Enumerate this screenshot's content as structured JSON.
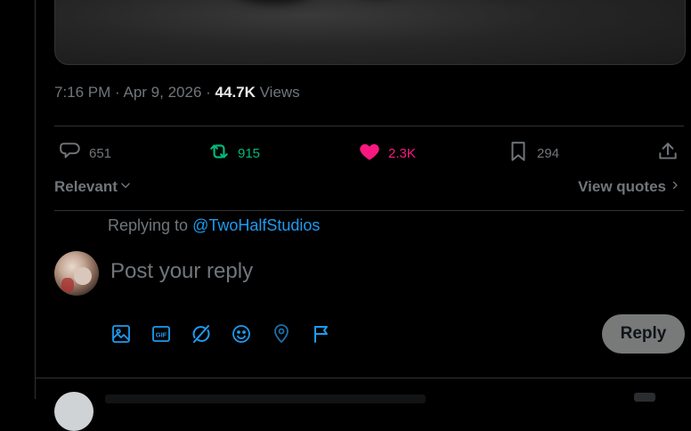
{
  "tweet": {
    "time": "7:16 PM",
    "date": "Apr 9, 2026",
    "views_count": "44.7K",
    "views_label": "Views"
  },
  "actions": {
    "replies": "651",
    "reposts": "915",
    "likes": "2.3K",
    "bookmarks": "294"
  },
  "replies_bar": {
    "sort_label": "Relevant",
    "quotes_label": "View quotes"
  },
  "composer": {
    "replying_prefix": "Replying to",
    "replying_handle": "@TwoHalfStudios",
    "placeholder": "Post your reply",
    "reply_button": "Reply"
  },
  "colors": {
    "background": "#000000",
    "accent": "#1d9bf0",
    "repost": "#00ba7c",
    "like": "#f91880",
    "muted": "#71767b"
  },
  "icons": [
    "reply-icon",
    "repost-icon",
    "heart-icon",
    "bookmark-icon",
    "share-icon",
    "image-icon",
    "gif-icon",
    "grok-icon",
    "emoji-icon",
    "location-icon",
    "flag-icon"
  ]
}
